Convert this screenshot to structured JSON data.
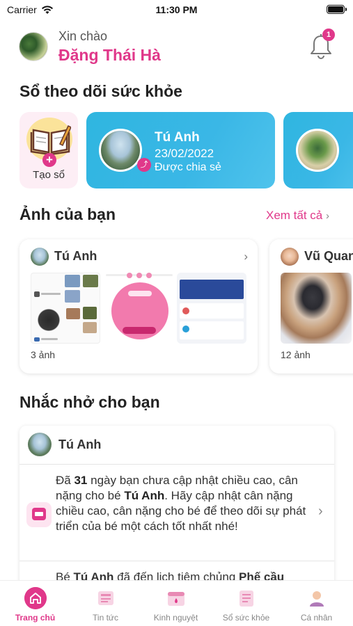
{
  "status_bar": {
    "carrier": "Carrier",
    "time": "11:30 PM"
  },
  "header": {
    "greeting": "Xin chào",
    "user_name": "Đặng Thái Hà",
    "notification_count": "1"
  },
  "health_books": {
    "title": "Sổ theo dõi sức khỏe",
    "create_label": "Tạo sổ",
    "cards": [
      {
        "name": "Tú Anh",
        "date": "23/02/2022",
        "status": "Được chia sẻ"
      }
    ]
  },
  "photos": {
    "title": "Ảnh của bạn",
    "see_all": "Xem tất cả",
    "albums": [
      {
        "name": "Tú Anh",
        "count": "3 ảnh"
      },
      {
        "name": "Vũ Quan",
        "count": "12 ảnh"
      }
    ]
  },
  "reminders": {
    "title": "Nhắc nhở cho bạn",
    "child_name": "Tú Anh",
    "message_1": {
      "p1": "Đã ",
      "days": "31",
      "p2": " ngày bạn chưa cập nhật chiều cao, cân nặng cho bé ",
      "child": "Tú Anh",
      "p3": ". Hãy cập nhật cân nặng chiều cao, cân nặng cho bé để theo dõi sự phát triển của bé một cách tốt nhất nhé!"
    },
    "message_2": {
      "p1": "Bé ",
      "child": "Tú Anh",
      "p2": " đã đến lịch tiêm chủng ",
      "vaccine": "Phế cầu"
    }
  },
  "bottom_nav": [
    {
      "label": "Trang chủ",
      "icon": "home-icon",
      "active": true
    },
    {
      "label": "Tin tức",
      "icon": "news-icon",
      "active": false
    },
    {
      "label": "Kinh nguyệt",
      "icon": "period-calendar-icon",
      "active": false
    },
    {
      "label": "Sổ sức khỏe",
      "icon": "health-book-icon",
      "active": false
    },
    {
      "label": "Cá nhân",
      "icon": "profile-icon",
      "active": false
    }
  ],
  "colors": {
    "accent": "#e0388a",
    "card_blue": "#3ab7e6"
  }
}
